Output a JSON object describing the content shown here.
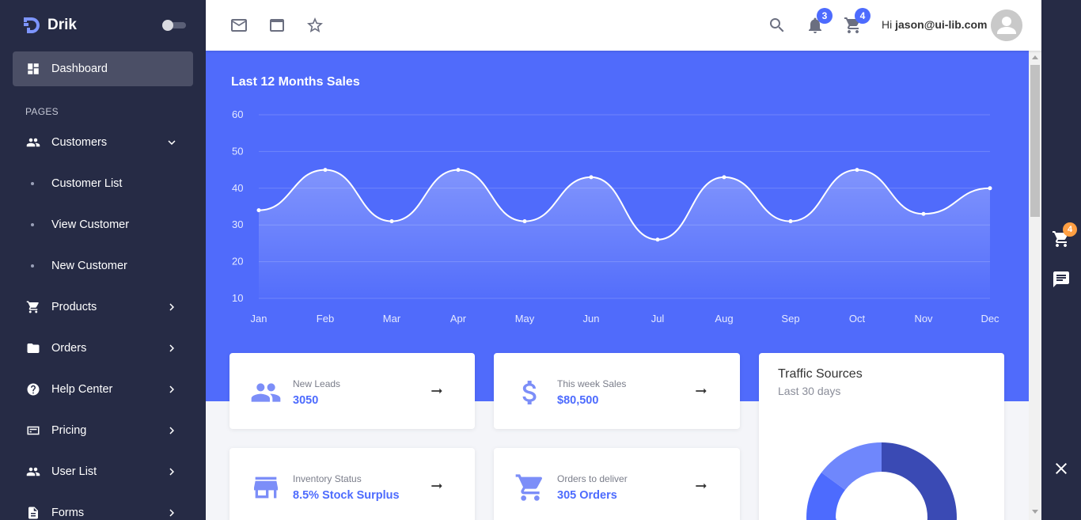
{
  "brand": {
    "name": "Drik"
  },
  "sidebar": {
    "section_label": "PAGES",
    "items": [
      {
        "label": "Dashboard",
        "icon": "dashboard-icon",
        "active": true
      },
      {
        "label": "Customers",
        "icon": "people-icon",
        "expanded": true
      },
      {
        "label": "Products",
        "icon": "cart-icon"
      },
      {
        "label": "Orders",
        "icon": "folder-icon"
      },
      {
        "label": "Help Center",
        "icon": "help-icon"
      },
      {
        "label": "Pricing",
        "icon": "pricing-icon"
      },
      {
        "label": "User List",
        "icon": "people-icon"
      },
      {
        "label": "Forms",
        "icon": "form-icon"
      }
    ],
    "customers_sub": [
      "Customer List",
      "View Customer",
      "New Customer"
    ]
  },
  "header": {
    "notifications_count": "3",
    "cart_count": "4",
    "greeting_prefix": "Hi",
    "user_email": "jason@ui-lib.com"
  },
  "sales_chart": {
    "title": "Last 12 Months Sales"
  },
  "chart_data": {
    "type": "area",
    "title": "Last 12 Months Sales",
    "categories": [
      "Jan",
      "Feb",
      "Mar",
      "Apr",
      "May",
      "Jun",
      "Jul",
      "Aug",
      "Sep",
      "Oct",
      "Nov",
      "Dec"
    ],
    "values": [
      34,
      45,
      31,
      45,
      31,
      43,
      26,
      43,
      31,
      45,
      33,
      40
    ],
    "yticks": [
      60,
      50,
      40,
      30,
      20,
      10
    ],
    "ylim": [
      10,
      60
    ],
    "grid": true,
    "line_color": "#ffffff",
    "background_color": "#506bfb"
  },
  "stats": [
    {
      "label": "New Leads",
      "value": "3050",
      "icon": "people-icon"
    },
    {
      "label": "This week Sales",
      "value": "$80,500",
      "icon": "dollar-icon"
    },
    {
      "label": "Inventory Status",
      "value": "8.5% Stock Surplus",
      "icon": "store-icon"
    },
    {
      "label": "Orders to deliver",
      "value": "305 Orders",
      "icon": "cart-icon"
    }
  ],
  "traffic": {
    "title": "Traffic Sources",
    "subtitle": "Last 30 days",
    "donut_colors": [
      "#3a4ab4",
      "#4d6bfe",
      "#6f87fc"
    ]
  },
  "right_rail": {
    "cart_count": "4"
  },
  "colors": {
    "sidebar": "#262b45",
    "accent": "#4d6bfe",
    "hero": "#506bfb",
    "badge_orange": "#ff9f43"
  }
}
